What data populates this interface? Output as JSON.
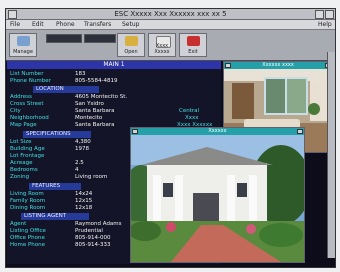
{
  "window": {
    "title": "ESC Xxxxx Xxx Xxxxxx xxx xx 5"
  },
  "menu": {
    "items": [
      "File",
      "Edit",
      "Phone",
      "Transfers",
      "Setup",
      "Help"
    ]
  },
  "toolbar": {
    "buttons": [
      {
        "label": "Manage",
        "icon": "house-icon"
      },
      {
        "label": "Open",
        "icon": "folder-icon"
      },
      {
        "label": "Xxxx Xxxxx",
        "icon": "document-icon"
      },
      {
        "label": "Exit",
        "icon": "exit-icon"
      }
    ]
  },
  "panel": {
    "title": "MAIN 1",
    "fields": [
      {
        "label": "List Number",
        "value": "183"
      },
      {
        "label": "Phone Number",
        "value": "805-5584-4819"
      }
    ],
    "location_title": "LOCATION",
    "location": [
      {
        "label": "Address",
        "value": "4605 Montecito St."
      },
      {
        "label": "Cross Street",
        "value": "San Ysidro"
      },
      {
        "label": "City",
        "value": "Santa Barbara",
        "label2": "Central"
      },
      {
        "label": "Neighborhood",
        "value": "Montecito",
        "label2": "Xxxx"
      },
      {
        "label": "Map Page",
        "value": "Santa Barbara",
        "label2": "Xxxx Xxxxxx"
      }
    ],
    "spec_title": "SPECIFICATIONS",
    "spec": [
      {
        "label": "Lot Size",
        "value": "4,380"
      },
      {
        "label": "Building Age",
        "value": "1978"
      },
      {
        "label": "Lot Frontage",
        "value": ""
      },
      {
        "label": "Acreage",
        "value": "2.5"
      },
      {
        "label": "Bedrooms",
        "value": "4"
      },
      {
        "label": "Zoning",
        "value": "Living room"
      }
    ],
    "features_title": "FEATURES",
    "features": [
      {
        "label": "Living Room",
        "value": "14x24"
      },
      {
        "label": "Family Room",
        "value": "12x15"
      },
      {
        "label": "Dining Room",
        "value": "12x18"
      }
    ],
    "listing_title": "LISTING AGENT",
    "listing": [
      {
        "label": "Agent",
        "value": "Raymond Adams"
      },
      {
        "label": "Listing Office",
        "value": "Prudential"
      },
      {
        "label": "Office Phone",
        "value": "805-914-000"
      },
      {
        "label": "Home Phone",
        "value": "805-914-333"
      }
    ]
  },
  "photo1": {
    "title": "Xxxxxx xxxx"
  },
  "photo2": {
    "title": "Xxxxxx"
  },
  "colors": {
    "accent": "#2c34a8",
    "label": "#3fe0e0",
    "photo_title": "#26a0a8"
  }
}
